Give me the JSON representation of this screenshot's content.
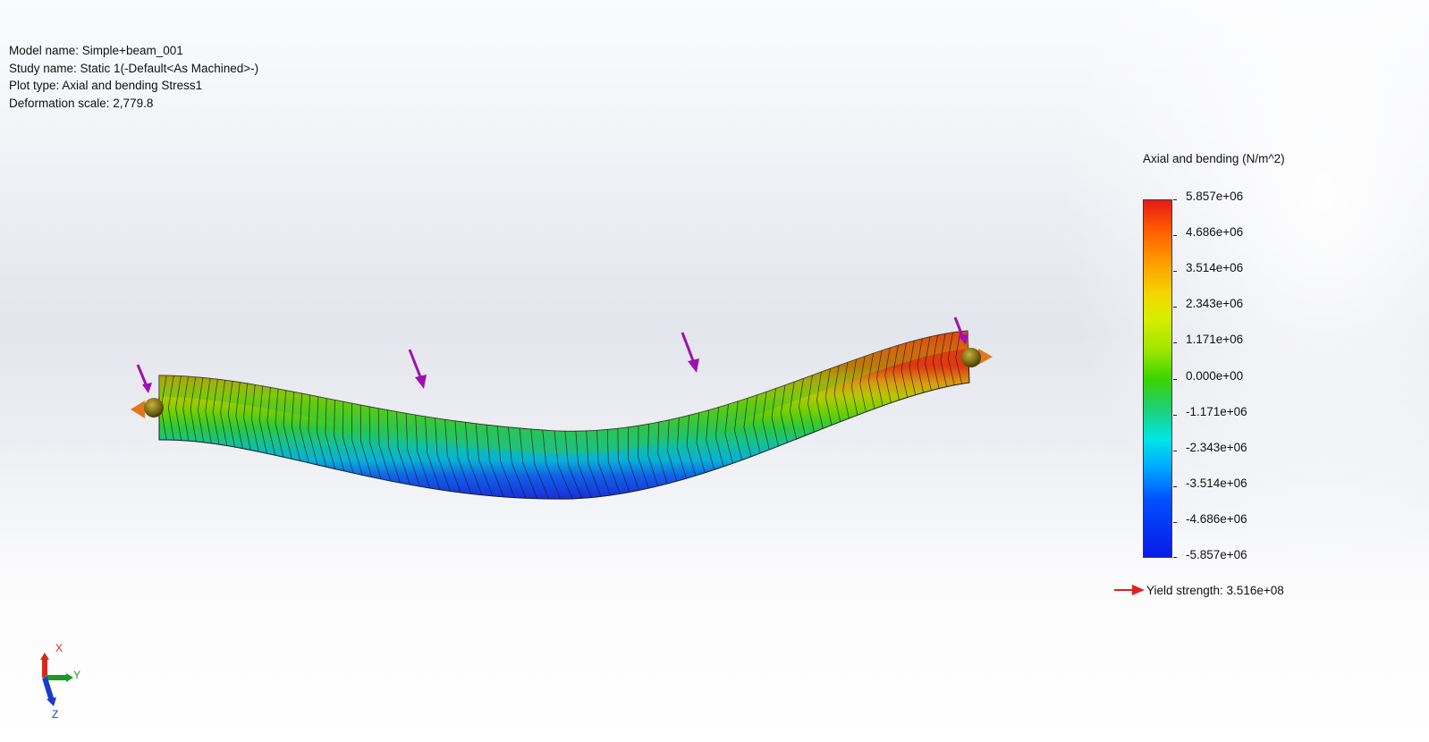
{
  "info": {
    "model_name": "Model name: Simple+beam_001",
    "study_name": "Study name: Static 1(-Default<As Machined>-)",
    "plot_type": "Plot type: Axial and bending Stress1",
    "deformation_scale": "Deformation scale: 2,779.8"
  },
  "legend": {
    "title": "Axial and bending (N/m^2)",
    "labels": [
      "5.857e+06",
      "4.686e+06",
      "3.514e+06",
      "2.343e+06",
      "1.171e+06",
      "0.000e+00",
      "-1.171e+06",
      "-2.343e+06",
      "-3.514e+06",
      "-4.686e+06",
      "-5.857e+06"
    ],
    "yield_strength": "Yield strength: 3.516e+08",
    "yield_color": "#e02020"
  },
  "triad": {
    "x_label": "X",
    "y_label": "Y",
    "z_label": "Z",
    "x_color": "#d02a1e",
    "y_color": "#1a9a2a",
    "z_color": "#1a3acc"
  },
  "colors": {
    "load_arrow": "#a010b0",
    "fixture": "#7a6a10",
    "fixture_arrow": "#e07820"
  },
  "icons": {
    "load_arrows": "distributed-load-arrow-icon",
    "fixtures": "fixture-icon",
    "triad": "reference-triad-icon"
  }
}
